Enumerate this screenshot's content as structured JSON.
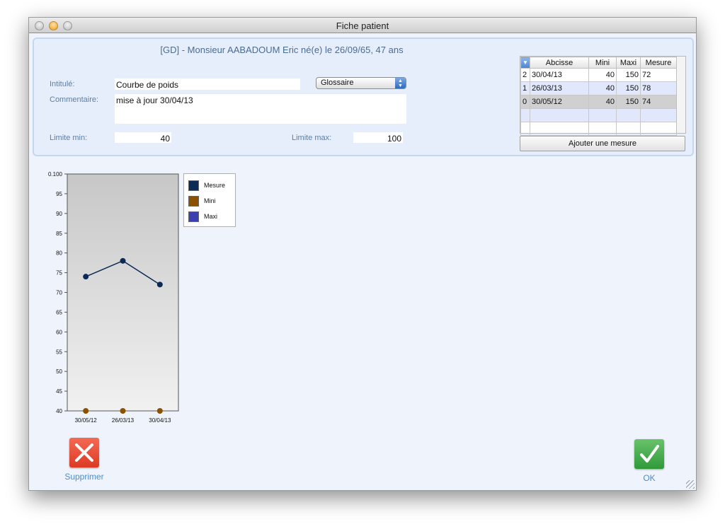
{
  "window": {
    "title": "Fiche patient"
  },
  "patient": {
    "header": "[GD] - Monsieur AABADOUM Eric   né(e) le 26/09/65, 47 ans"
  },
  "form": {
    "intitule_label": "Intitulé:",
    "intitule_value": "Courbe de poids",
    "glossaire_value": "Glossaire",
    "commentaire_label": "Commentaire:",
    "commentaire_value": "mise à jour  30/04/13",
    "limite_min_label": "Limite min:",
    "limite_min_value": "40",
    "limite_max_label": "Limite max:",
    "limite_max_value": "100"
  },
  "table": {
    "headers": [
      "Abcisse",
      "Mini",
      "Maxi",
      "Mesure"
    ],
    "rows": [
      {
        "idx": "2",
        "abcisse": "30/04/13",
        "mini": "40",
        "maxi": "150",
        "mesure": "72"
      },
      {
        "idx": "1",
        "abcisse": "26/03/13",
        "mini": "40",
        "maxi": "150",
        "mesure": "78"
      },
      {
        "idx": "0",
        "abcisse": "30/05/12",
        "mini": "40",
        "maxi": "150",
        "mesure": "74"
      }
    ],
    "add_button": "Ajouter une mesure"
  },
  "chart_data": {
    "type": "line",
    "x": [
      "30/05/12",
      "26/03/13",
      "30/04/13"
    ],
    "series": [
      {
        "name": "Mesure",
        "values": [
          74,
          78,
          72
        ],
        "color": "#0b2a55"
      },
      {
        "name": "Mini",
        "values": [
          40,
          40,
          40
        ],
        "color": "#8a5200"
      },
      {
        "name": "Maxi",
        "values": [
          150,
          150,
          150
        ],
        "color": "#3b3fb0"
      }
    ],
    "ylim": [
      40,
      100
    ],
    "yticks": [
      "0.100",
      "95",
      "90",
      "85",
      "80",
      "75",
      "70",
      "65",
      "60",
      "55",
      "50",
      "45",
      "40"
    ],
    "legend": "right"
  },
  "actions": {
    "delete_label": "Supprimer",
    "ok_label": "OK"
  }
}
